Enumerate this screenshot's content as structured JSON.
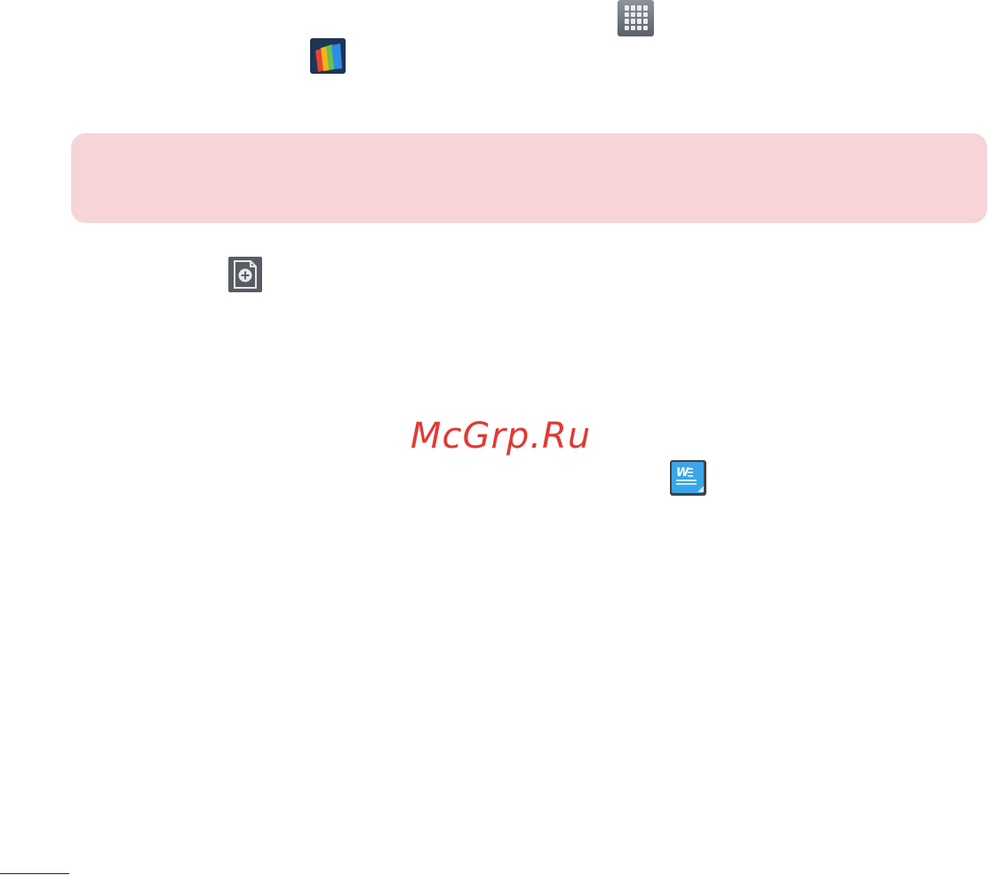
{
  "icons": {
    "apps": "apps-grid-icon",
    "office": "polaris-office-icon",
    "new_document": "new-document-icon",
    "word_document": "word-document-icon"
  },
  "watermark": {
    "text": "McGrp.Ru"
  },
  "colors": {
    "note_background": "#f6d4d7",
    "watermark": "#e03a33",
    "icon_dark": "#585c63",
    "word_blue": "#3aa6e8"
  }
}
